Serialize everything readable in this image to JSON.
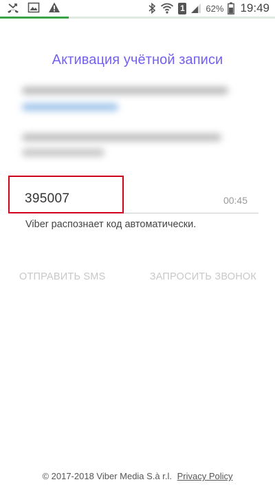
{
  "status_bar": {
    "icons_left": [
      "missed-call-icon",
      "image-icon",
      "warning-icon"
    ],
    "icons_right": [
      "bluetooth-icon",
      "wifi-icon",
      "sim-icon",
      "signal-icon",
      "battery-icon"
    ],
    "sim_label": "1",
    "battery_percent": "62%",
    "time": "19:49"
  },
  "progress": {
    "fraction": 0.25,
    "color": "#3aa346"
  },
  "title": "Активация учётной записи",
  "accent_color": "#7360f2",
  "code": {
    "value": "395007",
    "timer": "00:45",
    "highlight_color": "#d0021b"
  },
  "hint": "Viber распознает код автоматически.",
  "actions": {
    "send_sms": "Отправить SMS",
    "request_call": "Запросить звонок"
  },
  "footer": {
    "copyright": "© 2017-2018 Viber Media S.à r.l.",
    "privacy_link": "Privacy Policy"
  }
}
